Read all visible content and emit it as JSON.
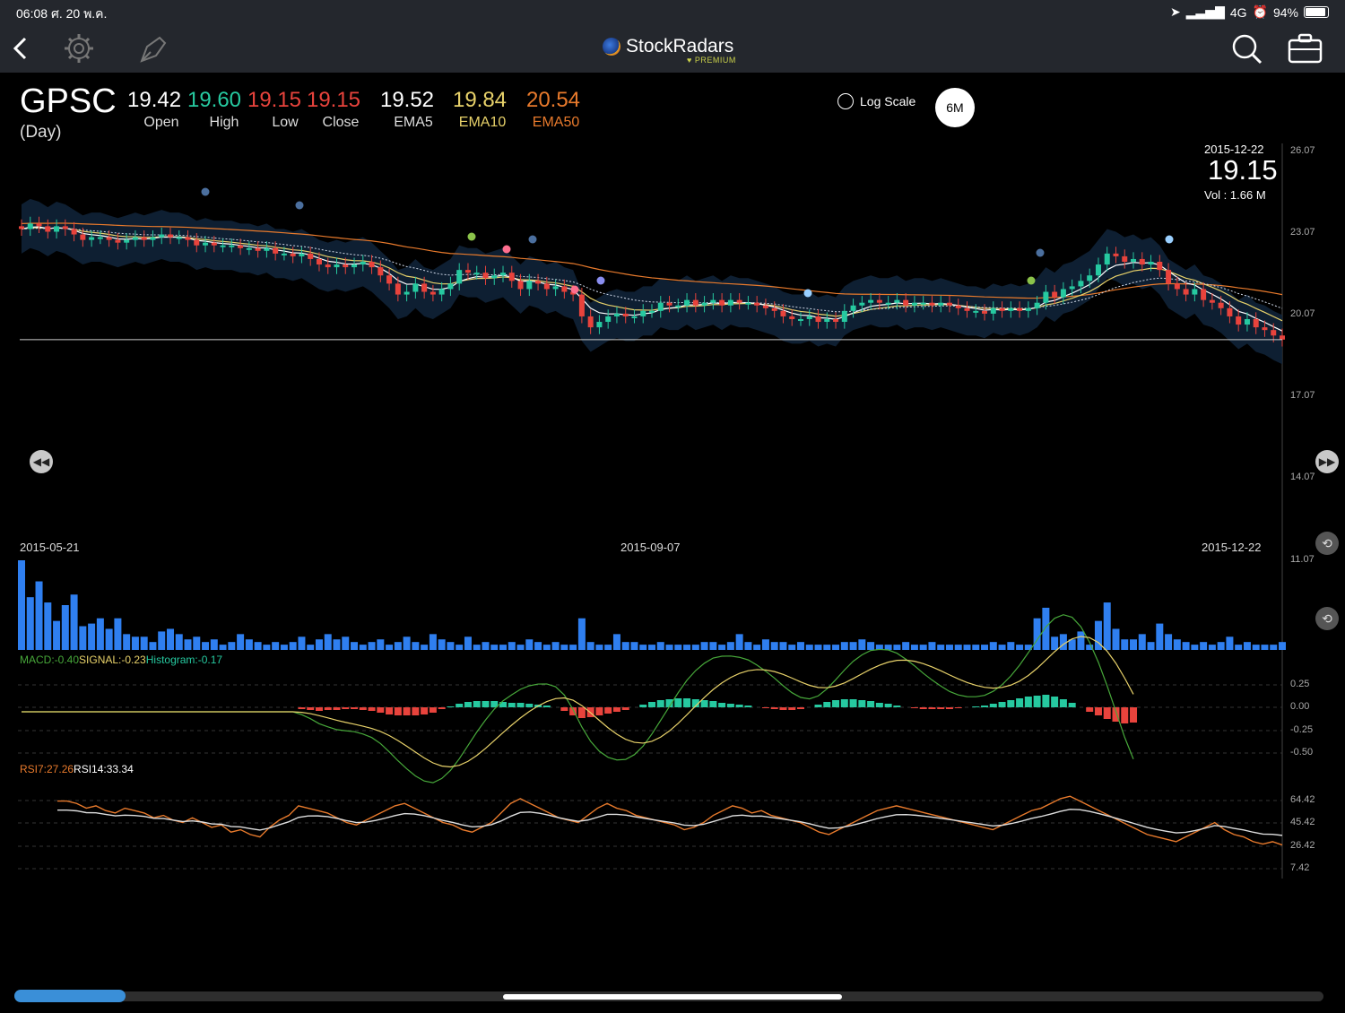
{
  "status_bar": {
    "time": "06:08",
    "date": "ศ. 20 พ.ค.",
    "network": "4G",
    "battery": "94%"
  },
  "nav": {
    "app_name": "StockRadars",
    "tier": "PREMIUM"
  },
  "quote": {
    "symbol": "GPSC",
    "period": "(Day)",
    "open": {
      "value": "19.42",
      "label": "Open"
    },
    "high": {
      "value": "19.60",
      "label": "High"
    },
    "low": {
      "value": "19.15",
      "label": "Low"
    },
    "close": {
      "value": "19.15",
      "label": "Close"
    },
    "ema5": {
      "value": "19.52",
      "label": "EMA5"
    },
    "ema10": {
      "value": "19.84",
      "label": "EMA10"
    },
    "ema50": {
      "value": "20.54",
      "label": "EMA50"
    }
  },
  "controls": {
    "log_scale": "Log Scale",
    "range": "6M"
  },
  "tooltip": {
    "date": "2015-12-22",
    "close": "19.15",
    "volume": "Vol    : 1.66 M"
  },
  "colors": {
    "up": "#26c9a0",
    "down": "#e8433c",
    "volume": "#2f7ff0",
    "ema5": "#ffffff",
    "ema10": "#e8d26a",
    "ema50": "#e87a2c",
    "macd": "#47a83a",
    "signal": "#e8d26a",
    "rsi7": "#e87a2c",
    "rsi14": "#dddddd"
  },
  "chart_data": {
    "type": "line",
    "title": "GPSC",
    "y_axis_ticks": [
      "26.07",
      "23.07",
      "20.07",
      "17.07",
      "14.07",
      "11.07"
    ],
    "x_axis_ticks": [
      "2015-05-21",
      "2015-09-07",
      "2015-12-22"
    ],
    "ylim": [
      11.07,
      26.07
    ],
    "price_close": [
      23.2,
      23.4,
      23.3,
      23.1,
      23.3,
      23.2,
      23.0,
      22.8,
      22.9,
      22.9,
      22.8,
      22.7,
      22.8,
      22.9,
      22.8,
      22.9,
      23.0,
      22.9,
      22.9,
      22.8,
      22.6,
      22.7,
      22.6,
      22.6,
      22.6,
      22.5,
      22.5,
      22.4,
      22.5,
      22.3,
      22.3,
      22.2,
      22.3,
      22.1,
      21.9,
      21.8,
      21.9,
      21.8,
      21.9,
      22.0,
      21.8,
      21.5,
      21.2,
      20.8,
      20.9,
      21.2,
      20.9,
      20.8,
      21.0,
      21.2,
      21.7,
      21.6,
      21.6,
      21.4,
      21.5,
      21.6,
      21.3,
      21.0,
      21.3,
      21.2,
      21.0,
      21.1,
      20.9,
      20.8,
      20.0,
      19.6,
      19.8,
      20.0,
      20.1,
      20.0,
      20.0,
      20.2,
      20.2,
      20.5,
      20.4,
      20.4,
      20.6,
      20.4,
      20.5,
      20.6,
      20.4,
      20.6,
      20.5,
      20.5,
      20.4,
      20.3,
      20.2,
      20.0,
      19.9,
      19.9,
      20.0,
      19.8,
      19.9,
      19.8,
      20.2,
      20.4,
      20.5,
      20.6,
      20.5,
      20.5,
      20.6,
      20.4,
      20.5,
      20.5,
      20.4,
      20.5,
      20.4,
      20.3,
      20.2,
      20.2,
      20.1,
      20.3,
      20.2,
      20.3,
      20.2,
      20.3,
      20.5,
      20.9,
      20.7,
      21.0,
      21.1,
      21.3,
      21.5,
      21.9,
      22.3,
      22.2,
      22.0,
      22.1,
      21.9,
      22.0,
      21.7,
      21.2,
      21.0,
      20.8,
      21.0,
      20.6,
      20.5,
      20.3,
      20.0,
      19.7,
      19.9,
      19.6,
      19.5,
      19.3,
      19.15
    ],
    "volume_m": [
      3.4,
      2.0,
      2.6,
      1.8,
      1.1,
      1.7,
      2.1,
      0.9,
      1.0,
      1.2,
      0.8,
      1.2,
      0.6,
      0.5,
      0.5,
      0.3,
      0.7,
      0.8,
      0.6,
      0.4,
      0.5,
      0.3,
      0.4,
      0.2,
      0.3,
      0.6,
      0.4,
      0.3,
      0.2,
      0.3,
      0.2,
      0.3,
      0.5,
      0.2,
      0.4,
      0.6,
      0.4,
      0.5,
      0.3,
      0.2,
      0.3,
      0.4,
      0.2,
      0.3,
      0.5,
      0.3,
      0.2,
      0.6,
      0.4,
      0.3,
      0.2,
      0.5,
      0.2,
      0.3,
      0.2,
      0.2,
      0.3,
      0.2,
      0.4,
      0.3,
      0.2,
      0.3,
      0.2,
      0.2,
      1.2,
      0.3,
      0.2,
      0.2,
      0.6,
      0.3,
      0.3,
      0.2,
      0.2,
      0.3,
      0.2,
      0.2,
      0.2,
      0.2,
      0.3,
      0.3,
      0.2,
      0.3,
      0.6,
      0.3,
      0.2,
      0.4,
      0.3,
      0.3,
      0.2,
      0.3,
      0.2,
      0.2,
      0.2,
      0.2,
      0.3,
      0.3,
      0.4,
      0.3,
      0.2,
      0.2,
      0.2,
      0.3,
      0.2,
      0.2,
      0.3,
      0.2,
      0.2,
      0.2,
      0.2,
      0.2,
      0.2,
      0.3,
      0.2,
      0.3,
      0.2,
      0.2,
      1.2,
      1.6,
      0.5,
      0.6,
      0.4,
      0.7,
      0.2,
      1.1,
      1.8,
      0.8,
      0.4,
      0.4,
      0.6,
      0.3,
      1.0,
      0.6,
      0.4,
      0.3,
      0.2,
      0.3,
      0.2,
      0.3,
      0.5,
      0.2,
      0.3,
      0.2,
      0.2,
      0.2,
      0.3
    ],
    "macd_hist": [
      0,
      0,
      0,
      0,
      0,
      0,
      0,
      0,
      0,
      0,
      0,
      0,
      0,
      0,
      0,
      0,
      0,
      0,
      0,
      0,
      0,
      0,
      0,
      0,
      0,
      0,
      0,
      0,
      0,
      0,
      0,
      0,
      -0.02,
      -0.03,
      -0.04,
      -0.03,
      -0.03,
      -0.02,
      -0.02,
      -0.03,
      -0.04,
      -0.06,
      -0.08,
      -0.09,
      -0.09,
      -0.09,
      -0.08,
      -0.06,
      -0.02,
      0.01,
      0.04,
      0.06,
      0.07,
      0.07,
      0.07,
      0.06,
      0.05,
      0.05,
      0.04,
      0.03,
      0.02,
      0.0,
      -0.04,
      -0.09,
      -0.12,
      -0.11,
      -0.09,
      -0.07,
      -0.05,
      -0.03,
      0.0,
      0.03,
      0.06,
      0.08,
      0.09,
      0.1,
      0.1,
      0.09,
      0.08,
      0.07,
      0.05,
      0.04,
      0.03,
      0.02,
      0.0,
      -0.01,
      -0.02,
      -0.03,
      -0.03,
      -0.02,
      0.0,
      0.03,
      0.06,
      0.08,
      0.09,
      0.09,
      0.08,
      0.07,
      0.05,
      0.04,
      0.02,
      0.0,
      -0.01,
      -0.02,
      -0.02,
      -0.02,
      -0.02,
      -0.01,
      0.0,
      0.01,
      0.02,
      0.04,
      0.06,
      0.08,
      0.1,
      0.12,
      0.13,
      0.14,
      0.12,
      0.09,
      0.05,
      0.0,
      -0.05,
      -0.09,
      -0.13,
      -0.16,
      -0.18,
      -0.17
    ],
    "rsi7": [
      64,
      64,
      62,
      58,
      60,
      56,
      54,
      58,
      56,
      54,
      50,
      52,
      48,
      46,
      50,
      46,
      42,
      44,
      38,
      40,
      36,
      34,
      42,
      48,
      52,
      60,
      58,
      56,
      54,
      50,
      46,
      44,
      48,
      52,
      56,
      60,
      62,
      58,
      54,
      50,
      46,
      44,
      40,
      38,
      42,
      46,
      54,
      62,
      66,
      62,
      58,
      54,
      50,
      48,
      46,
      52,
      58,
      62,
      58,
      56,
      52,
      50,
      48,
      46,
      44,
      40,
      42,
      46,
      52,
      56,
      60,
      58,
      54,
      56,
      52,
      50,
      48,
      46,
      42,
      38,
      36,
      40,
      44,
      48,
      52,
      56,
      58,
      60,
      58,
      56,
      54,
      52,
      50,
      48,
      46,
      44,
      42,
      40,
      44,
      48,
      52,
      56,
      58,
      62,
      66,
      68,
      64,
      60,
      56,
      52,
      48,
      44,
      40,
      36,
      34,
      32,
      30,
      34,
      38,
      42,
      46,
      40,
      36,
      34,
      30,
      28,
      30,
      27.26
    ]
  },
  "indicators": {
    "macd": {
      "macd": "MACD:-0.40",
      "signal": "SIGNAL:-0.23",
      "histogram": "Histogram:-0.17",
      "ticks": [
        "0.25",
        "0.00",
        "-0.25",
        "-0.50"
      ]
    },
    "rsi": {
      "rsi7": "RSI7:27.26",
      "rsi14": "RSI14:33.34",
      "ticks": [
        "64.42",
        "45.42",
        "26.42",
        "7.42"
      ]
    }
  }
}
